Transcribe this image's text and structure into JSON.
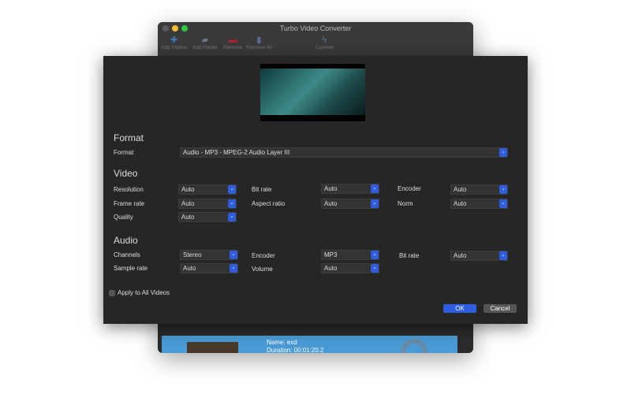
{
  "window": {
    "title": "Turbo Video Converter",
    "toolbar": [
      {
        "label": "Add Videos",
        "icon": "plus-icon"
      },
      {
        "label": "Add Folder",
        "icon": "folder-icon"
      },
      {
        "label": "Remove",
        "icon": "minus-icon"
      },
      {
        "label": "Remove All",
        "icon": "trash-icon"
      },
      {
        "label": "Convert",
        "icon": "lightning-icon"
      }
    ],
    "list_item": {
      "name": "Name: exd",
      "duration": "Duration:  00:01:20.2"
    }
  },
  "dialog": {
    "format_heading": "Format",
    "format_label": "Format",
    "format_value": "Audio - MP3 - MPEG-2 Audio Layer III",
    "video_heading": "Video",
    "video": {
      "resolution": {
        "label": "Resolution",
        "value": "Auto"
      },
      "bitrate": {
        "label": "Bit rate",
        "value": "Auto"
      },
      "encoder": {
        "label": "Encoder",
        "value": "Auto"
      },
      "framerate": {
        "label": "Frame rate",
        "value": "Auto"
      },
      "aspect": {
        "label": "Aspect ratio",
        "value": "Auto"
      },
      "norm": {
        "label": "Norm",
        "value": "Auto"
      },
      "quality": {
        "label": "Quality",
        "value": "Auto"
      }
    },
    "audio_heading": "Audio",
    "audio": {
      "channels": {
        "label": "Channels",
        "value": "Stereo"
      },
      "encoder": {
        "label": "Encoder",
        "value": "MP3"
      },
      "bitrate": {
        "label": "Bit rate",
        "value": "Auto"
      },
      "samplerate": {
        "label": "Sample rate",
        "value": "Auto"
      },
      "volume": {
        "label": "Volume",
        "value": "Auto"
      }
    },
    "apply_all": "Apply to All Videos",
    "ok": "OK",
    "cancel": "Cancel"
  }
}
